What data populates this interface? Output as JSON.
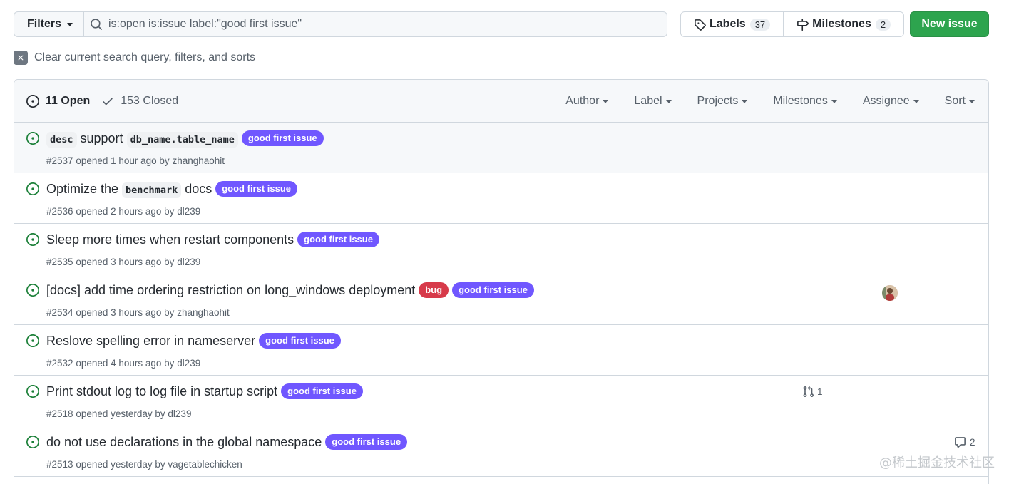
{
  "toolbar": {
    "filters_label": "Filters",
    "search_value": "is:open is:issue label:\"good first issue\"",
    "labels_label": "Labels",
    "labels_count": "37",
    "milestones_label": "Milestones",
    "milestones_count": "2",
    "new_issue_label": "New issue"
  },
  "clear_filters": {
    "label": "Clear current search query, filters, and sorts"
  },
  "header": {
    "open_label": "11 Open",
    "closed_label": "153 Closed",
    "filters": [
      "Author",
      "Label",
      "Projects",
      "Milestones",
      "Assignee",
      "Sort"
    ]
  },
  "colors": {
    "good_first_issue": "#7057ff",
    "bug": "#d73a4a",
    "open_green": "#1a7f37",
    "new_issue_bg": "#2da44e"
  },
  "issues": [
    {
      "title_parts": [
        {
          "text": "desc",
          "code": true
        },
        {
          "text": " support ",
          "code": false
        },
        {
          "text": "db_name.table_name",
          "code": true
        }
      ],
      "labels": [
        {
          "text": "good first issue",
          "color": "#7057ff"
        }
      ],
      "number": "#2537",
      "opened": "opened 1 hour ago by",
      "author": "zhanghaohit"
    },
    {
      "title_parts": [
        {
          "text": "Optimize the ",
          "code": false
        },
        {
          "text": "benchmark",
          "code": true
        },
        {
          "text": " docs",
          "code": false
        }
      ],
      "labels": [
        {
          "text": "good first issue",
          "color": "#7057ff"
        }
      ],
      "number": "#2536",
      "opened": "opened 2 hours ago by",
      "author": "dl239"
    },
    {
      "title_parts": [
        {
          "text": "Sleep more times when restart components",
          "code": false
        }
      ],
      "labels": [
        {
          "text": "good first issue",
          "color": "#7057ff"
        }
      ],
      "number": "#2535",
      "opened": "opened 3 hours ago by",
      "author": "dl239"
    },
    {
      "title_parts": [
        {
          "text": "[docs] add time ordering restriction on long_windows deployment",
          "code": false
        }
      ],
      "labels": [
        {
          "text": "bug",
          "color": "#d73a4a"
        },
        {
          "text": "good first issue",
          "color": "#7057ff"
        }
      ],
      "number": "#2534",
      "opened": "opened 3 hours ago by",
      "author": "zhanghaohit",
      "assignee_avatar": "avatar-icon"
    },
    {
      "title_parts": [
        {
          "text": "Reslove spelling error in nameserver",
          "code": false
        }
      ],
      "labels": [
        {
          "text": "good first issue",
          "color": "#7057ff"
        }
      ],
      "number": "#2532",
      "opened": "opened 4 hours ago by",
      "author": "dl239"
    },
    {
      "title_parts": [
        {
          "text": "Print stdout log to log file in startup script",
          "code": false
        }
      ],
      "labels": [
        {
          "text": "good first issue",
          "color": "#7057ff"
        }
      ],
      "number": "#2518",
      "opened": "opened yesterday by",
      "author": "dl239",
      "linked_prs": "1"
    },
    {
      "title_parts": [
        {
          "text": "do not use declarations in the global namespace",
          "code": false
        }
      ],
      "labels": [
        {
          "text": "good first issue",
          "color": "#7057ff"
        }
      ],
      "number": "#2513",
      "opened": "opened yesterday by",
      "author": "vagetablechicken",
      "comments": "2"
    }
  ],
  "watermark": "@稀土掘金技术社区"
}
